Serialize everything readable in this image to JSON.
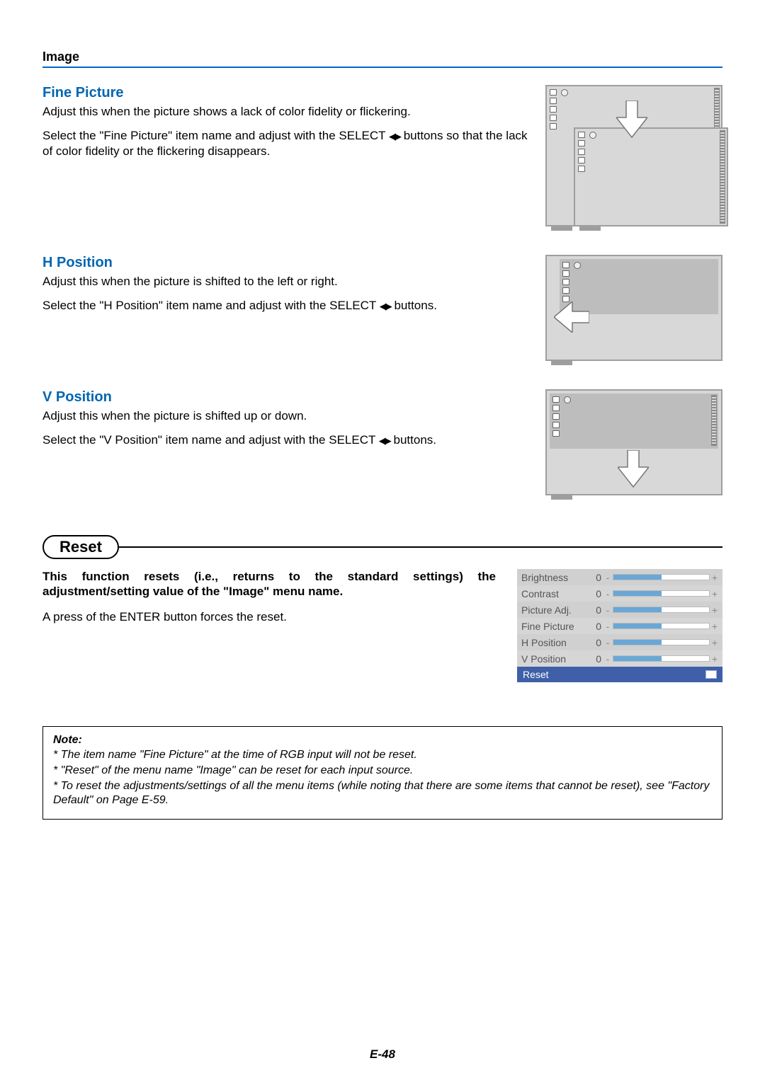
{
  "breadcrumb": "Image",
  "sections": {
    "finePicture": {
      "title": "Fine Picture",
      "p1": "Adjust this when the picture shows a lack of color fidelity or flickering.",
      "p2a": "Select the \"Fine Picture\" item name and adjust with the SELECT ",
      "p2b": " buttons so that the lack of color fidelity or the flickering disappears."
    },
    "hPosition": {
      "title": "H Position",
      "p1": "Adjust this when the picture is shifted to the left or right.",
      "p2a": "Select the \"H Position\" item name and adjust with the SELECT ",
      "p2b": " buttons."
    },
    "vPosition": {
      "title": "V Position",
      "p1": "Adjust this when the picture is shifted up or down.",
      "p2a": "Select the \"V Position\" item name and adjust with the SELECT ",
      "p2b": " buttons."
    }
  },
  "reset": {
    "title": "Reset",
    "bold": "This function resets (i.e., returns to the standard settings) the adjustment/setting value of the \"Image\" menu name.",
    "p": "A press of the ENTER button forces the reset."
  },
  "osd": {
    "rows": [
      {
        "label": "Brightness",
        "val": "0"
      },
      {
        "label": "Contrast",
        "val": "0"
      },
      {
        "label": "Picture Adj.",
        "val": "0"
      },
      {
        "label": "Fine Picture",
        "val": "0"
      },
      {
        "label": "H Position",
        "val": "0"
      },
      {
        "label": "V Position",
        "val": "0"
      }
    ],
    "resetLabel": "Reset"
  },
  "note": {
    "hd": "Note:",
    "l1": "*  The item name \"Fine Picture\" at the time of RGB input will not be reset.",
    "l2": "*  \"Reset\" of the menu name \"Image\" can be reset for each input source.",
    "l3": "*  To reset the adjustments/settings of all the menu items (while noting that there are some items that cannot be reset), see \"Factory Default\" on Page E-59."
  },
  "footer": "E-48"
}
